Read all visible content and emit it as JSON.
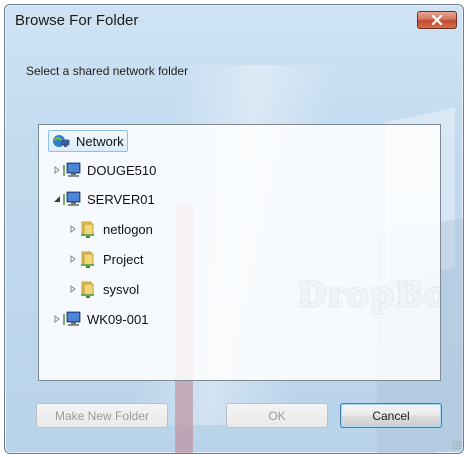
{
  "window": {
    "title": "Browse For Folder",
    "close_glyph": "✕"
  },
  "instruction": "Select a shared network folder",
  "tree": {
    "items": [
      {
        "label": "Network",
        "icon": "network-icon",
        "expanded": true,
        "selected": true
      },
      {
        "label": "DOUGE510",
        "icon": "computer-icon",
        "expanded": false
      },
      {
        "label": "SERVER01",
        "icon": "computer-icon",
        "expanded": true
      },
      {
        "label": "netlogon",
        "icon": "shared-folder-icon",
        "expanded": false
      },
      {
        "label": "Project",
        "icon": "shared-folder-icon",
        "expanded": false
      },
      {
        "label": "sysvol",
        "icon": "shared-folder-icon",
        "expanded": false
      },
      {
        "label": "WK09-001",
        "icon": "computer-icon",
        "expanded": false
      }
    ]
  },
  "watermark": "DropBo",
  "buttons": {
    "make_new_folder": "Make New Folder",
    "ok": "OK",
    "cancel": "Cancel"
  },
  "colors": {
    "accent": "#8fc0e9",
    "close_button": "#c04a2d"
  }
}
